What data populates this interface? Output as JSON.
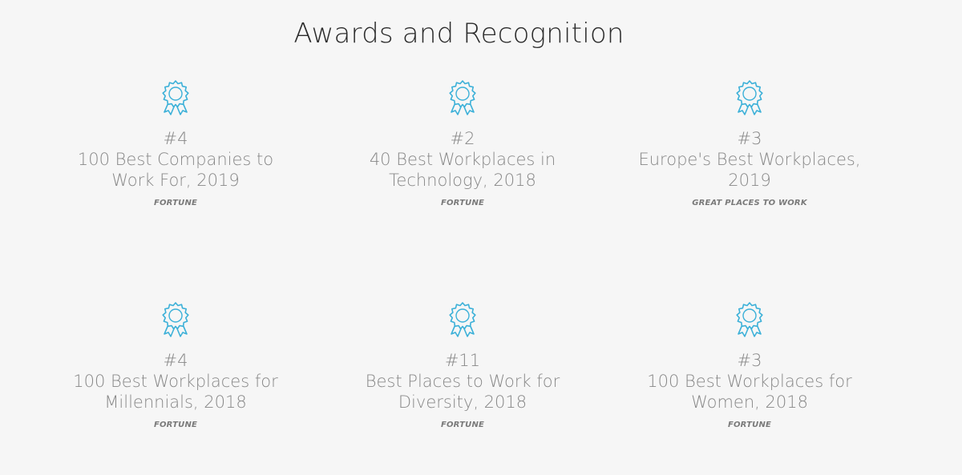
{
  "section": {
    "title": "Awards and Recognition",
    "accent_color": "#3bb0d8",
    "icon_name": "award-ribbon-icon"
  },
  "awards": [
    {
      "rank": "#4",
      "name": "100 Best Companies to Work For, 2019",
      "source": "FORTUNE"
    },
    {
      "rank": "#2",
      "name": "40 Best Workplaces in Technology, 2018",
      "source": "FORTUNE"
    },
    {
      "rank": "#3",
      "name": "Europe's Best Workplaces, 2019",
      "source": "GREAT PLACES TO WORK"
    },
    {
      "rank": "#4",
      "name": "100 Best Workplaces for Millennials, 2018",
      "source": "FORTUNE"
    },
    {
      "rank": "#11",
      "name": "Best Places to Work for Diversity, 2018",
      "source": "FORTUNE"
    },
    {
      "rank": "#3",
      "name": "100 Best Workplaces for Women, 2018",
      "source": "FORTUNE"
    }
  ]
}
